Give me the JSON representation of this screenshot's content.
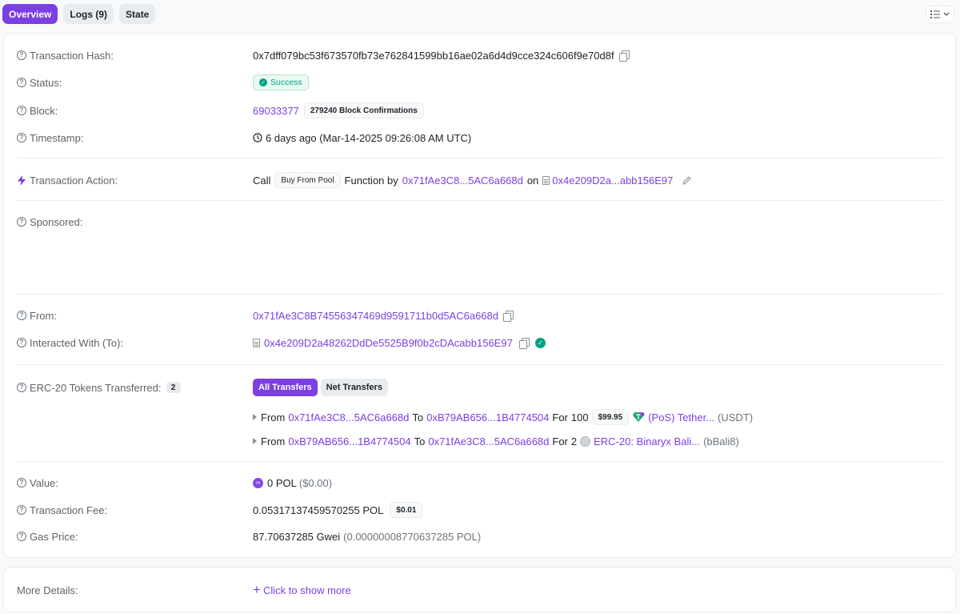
{
  "tabs": [
    {
      "label": "Overview",
      "active": true
    },
    {
      "label": "Logs (9)",
      "active": false
    },
    {
      "label": "State",
      "active": false
    }
  ],
  "overview": {
    "tx_hash": {
      "label": "Transaction Hash:",
      "value": "0x7dff079bc53f673570fb73e762841599bb16ae02a6d4d9cce324c606f9e70d8f"
    },
    "status": {
      "label": "Status:",
      "value": "Success"
    },
    "block": {
      "label": "Block:",
      "number": "69033377",
      "confirmations": "279240 Block Confirmations"
    },
    "timestamp": {
      "label": "Timestamp:",
      "value": "6 days ago (Mar-14-2025 09:26:08 AM UTC)"
    },
    "action": {
      "label": "Transaction Action:",
      "call": "Call",
      "method": "Buy From Pool",
      "function_by": "Function by",
      "from": "0x71fAe3C8...5AC6a668d",
      "on": "on",
      "contract": "0x4e209D2a...abb156E97"
    },
    "sponsored": {
      "label": "Sponsored:"
    },
    "from": {
      "label": "From:",
      "value": "0x71fAe3C8B74556347469d9591711b0d5AC6a668d"
    },
    "to": {
      "label": "Interacted With (To):",
      "value": "0x4e209D2a48262DdDe5525B9f0b2cDAcabb156E97"
    },
    "erc20": {
      "label": "ERC-20 Tokens Transferred:",
      "count": "2",
      "all_label": "All Transfers",
      "net_label": "Net Transfers",
      "transfers": [
        {
          "from_word": "From",
          "from": "0x71fAe3C8...5AC6a668d",
          "to_word": "To",
          "to": "0xB79AB656...1B4774504",
          "for_word": "For",
          "amount": "100",
          "usd": "$99.95",
          "token": "(PoS) Tether...",
          "symbol": "(USDT)"
        },
        {
          "from_word": "From",
          "from": "0xB79AB656...1B4774504",
          "to_word": "To",
          "to": "0x71fAe3C8...5AC6a668d",
          "for_word": "For",
          "amount": "2",
          "usd": "",
          "token": "ERC-20: Binaryx Bali...",
          "symbol": "(bBali8)"
        }
      ]
    },
    "value": {
      "label": "Value:",
      "amount": "0 POL",
      "usd": "($0.00)"
    },
    "fee": {
      "label": "Transaction Fee:",
      "amount": "0.05317137459570255 POL",
      "usd": "$0.01"
    },
    "gas": {
      "label": "Gas Price:",
      "gwei": "87.70637285 Gwei",
      "pol": "(0.00000008770637285 POL)"
    }
  },
  "more": {
    "label": "More Details:",
    "link": "Click to show more"
  },
  "colors": {
    "accent": "#7b3fe4",
    "success": "#00a186"
  }
}
